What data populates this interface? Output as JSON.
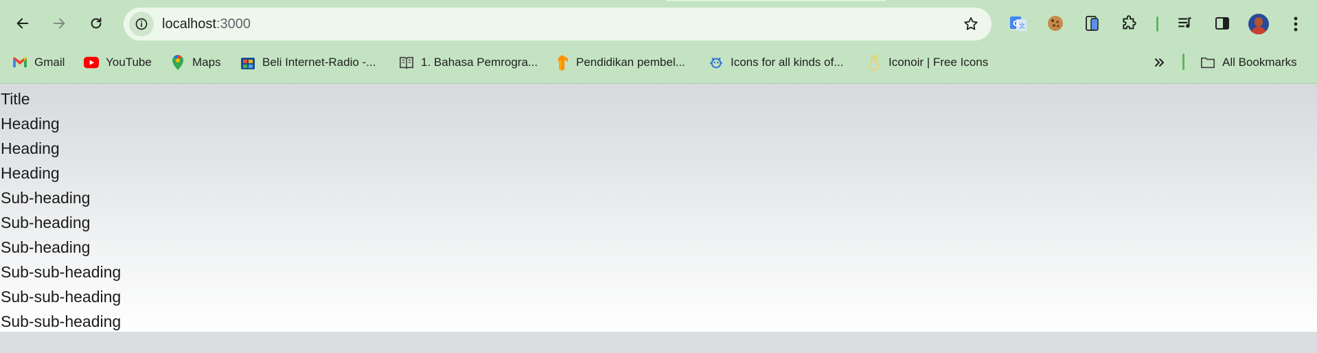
{
  "toolbar": {
    "url_host": "localhost",
    "url_port": ":3000"
  },
  "bookmarks": {
    "items": [
      {
        "label": "Gmail",
        "icon": "gmail-icon"
      },
      {
        "label": "YouTube",
        "icon": "youtube-icon"
      },
      {
        "label": "Maps",
        "icon": "maps-icon"
      },
      {
        "label": "Beli Internet-Radio -...",
        "icon": "radio-store-icon"
      },
      {
        "label": "1. Bahasa Pemrogra...",
        "icon": "book-icon"
      },
      {
        "label": "Pendidikan pembel...",
        "icon": "tensorflow-icon"
      },
      {
        "label": "Icons for all kinds of...",
        "icon": "icons-site-icon"
      },
      {
        "label": "Iconoir | Free Icons",
        "icon": "peace-hand-icon"
      }
    ],
    "all_bookmarks": "All Bookmarks"
  },
  "page": {
    "lines": [
      "Title",
      "Heading",
      "Heading",
      "Heading",
      "Sub-heading",
      "Sub-heading",
      "Sub-heading",
      "Sub-sub-heading",
      "Sub-sub-heading",
      "Sub-sub-heading"
    ]
  },
  "colors": {
    "chrome_green": "#c4e3c2",
    "omnibox": "#eef7ec",
    "accent_green": "#62b262"
  }
}
